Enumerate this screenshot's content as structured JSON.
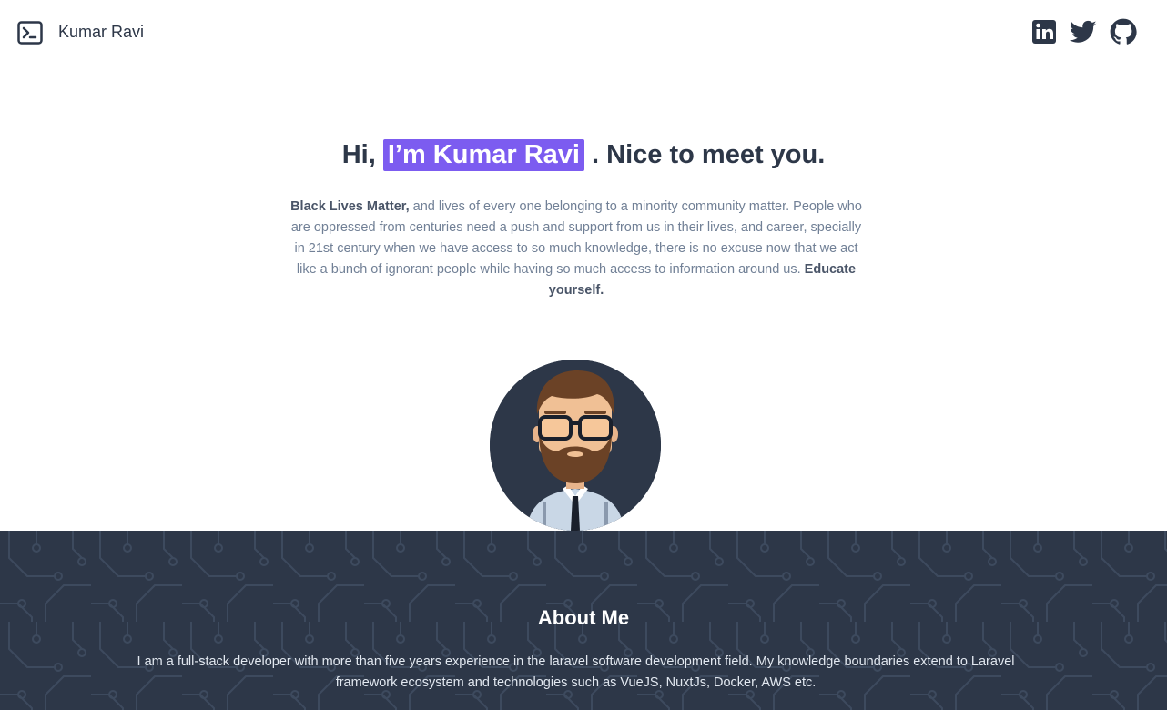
{
  "header": {
    "logo_icon": "terminal-icon",
    "brand": "Kumar Ravi",
    "social": [
      {
        "name": "LinkedIn",
        "icon": "linkedin-icon"
      },
      {
        "name": "Twitter",
        "icon": "twitter-icon"
      },
      {
        "name": "GitHub",
        "icon": "github-icon"
      }
    ]
  },
  "hero": {
    "greeting": "Hi,",
    "highlight": "I’m Kumar Ravi",
    "rest": ". Nice to meet you.",
    "intro_bold": "Black Lives Matter,",
    "intro_text": " and lives of every one belonging to a minority community matter. People who are oppressed from centuries need a push and support from us in their lives, and career, specially in 21st century when we have access to so much knowledge, there is no excuse now that we act like a bunch of ignorant people while having so much access to information around us. ",
    "intro_end_bold": "Educate yourself."
  },
  "avatar": {
    "icon": "avatar-illustration"
  },
  "about": {
    "title": "About Me",
    "text": "I am a full-stack developer with more than five years experience in the laravel software development field. My knowledge boundaries extend to Laravel framework ecosystem and technologies such as VueJS, NuxtJs, Docker, AWS etc."
  },
  "colors": {
    "accent": "#7c5cf0",
    "text_dark": "#2d3748",
    "text_muted": "#718096",
    "about_bg": "#2d3748"
  }
}
